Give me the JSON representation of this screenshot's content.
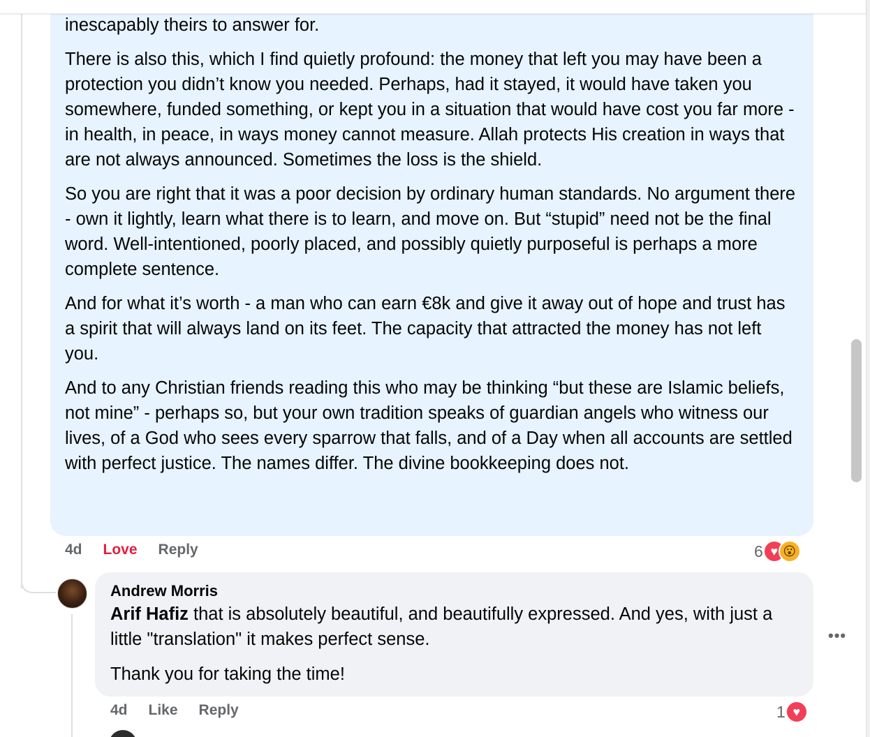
{
  "main_comment": {
    "paragraphs": [
      "inescapably theirs to answer for.",
      "There is also this, which I find quietly profound: the money that left you may have been a protection you didn’t know you needed. Perhaps, had it stayed, it would have taken you somewhere, funded something, or kept you in a situation that would have cost you far more - in health, in peace, in ways money cannot measure. Allah protects His creation in ways that are not always announced. Sometimes the loss is the shield.",
      "So you are right that it was a poor decision by ordinary human standards. No argument there - own it lightly, learn what there is to learn, and move on. But “stupid” need not be the final word. Well-intentioned, poorly placed, and possibly quietly purposeful is perhaps a more complete sentence.",
      "And for what it’s worth - a man who can earn €8k and give it away out of hope and trust has a spirit that will always land on its feet. The capacity that attracted the money has not left you.",
      "And to any Christian friends reading this who may be thinking “but these are Islamic beliefs, not mine” - perhaps so, but your own tradition speaks of guardian angels who witness our lives, of a God who sees every sparrow that falls, and of a Day when all accounts are settled with perfect justice. The names differ. The divine bookkeeping does not."
    ],
    "actions": {
      "time": "4d",
      "love": "Love",
      "reply": "Reply"
    },
    "reaction_count": "6",
    "reactions": [
      "heart-icon",
      "wow-icon"
    ]
  },
  "reply_comment": {
    "author": "Andrew Morris",
    "mention": "Arif Hafiz",
    "text_1": " that is absolutely beautiful, and beautifully expressed. And yes, with just a little \"translation\" it makes perfect sense.",
    "text_2": "Thank you for taking the time!",
    "actions": {
      "time": "4d",
      "like": "Like",
      "reply": "Reply"
    },
    "reaction_count": "1",
    "reactions": [
      "heart-icon"
    ]
  },
  "colors": {
    "main_bubble": "#e7f3ff",
    "reply_bubble": "#f0f2f5",
    "love_red": "#e41e3f",
    "meta_grey": "#65676b"
  }
}
